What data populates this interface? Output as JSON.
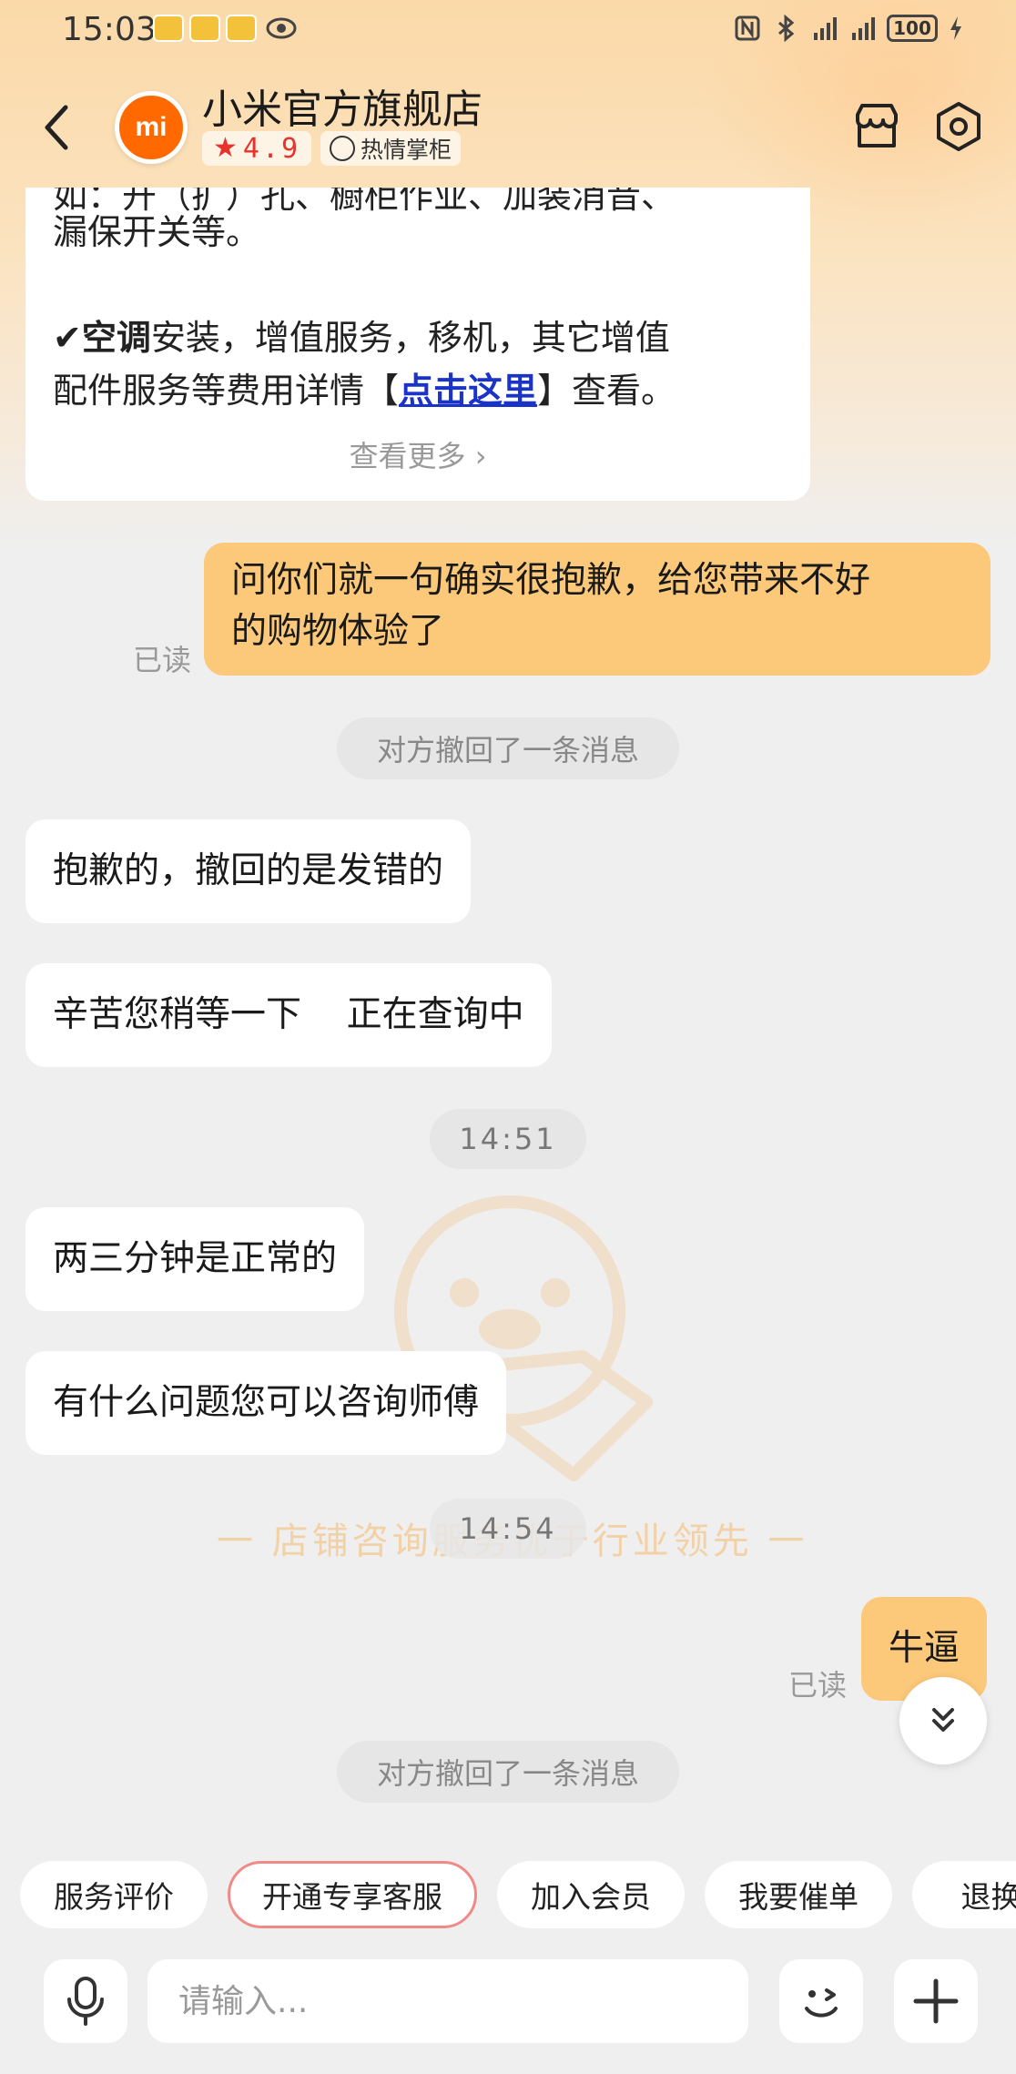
{
  "status_bar": {
    "time": "15:03",
    "battery": "100",
    "icons": [
      "nfc-icon",
      "bluetooth-icon",
      "signal-4g-icon",
      "signal-4g-icon",
      "battery-icon",
      "charging-icon"
    ]
  },
  "header": {
    "shop_name": "小米官方旗舰店",
    "rating": "4.9",
    "host_badge": "热情掌柜",
    "logo_text": "mi"
  },
  "card": {
    "cut_line": "如：开（扩）孔、橱柜作业、加装消音、",
    "line1": "漏保开关等。",
    "check": "✔",
    "ac_bold": "空调",
    "line3_rest": "安装，增值服务，移机，其它增值",
    "line4_pre": "配件服务等费用详情【",
    "link": "点击这里",
    "line4_post": "】查看。",
    "see_more": "查看更多",
    "see_more_arrow": "›"
  },
  "messages": {
    "m1_text": "问你们就一句确实很抱歉，给您带来不好",
    "m1_text2": "的购物体验了",
    "m1_read": "已读",
    "recall1": "对方撤回了一条消息",
    "m2": "抱歉的，撤回的是发错的",
    "m3": "辛苦您稍等一下    正在查询中",
    "time1": "14:51",
    "m4": "两三分钟是正常的",
    "m5": "有什么问题您可以咨询师傅",
    "time2": "14:54",
    "m6": "牛逼",
    "m6_read": "已读",
    "recall2": "对方撤回了一条消息"
  },
  "watermark_text": "一  店铺咨询服务优于行业领先  一",
  "quick_actions": [
    "服务评价",
    "开通专享客服",
    "加入会员",
    "我要催单",
    "退换货"
  ],
  "input": {
    "placeholder": "请输入..."
  },
  "colors": {
    "accent_orange": "#fcc87a",
    "brand": "#ff6900",
    "rating_red": "#e8322b",
    "link_blue": "#1a33c8"
  }
}
